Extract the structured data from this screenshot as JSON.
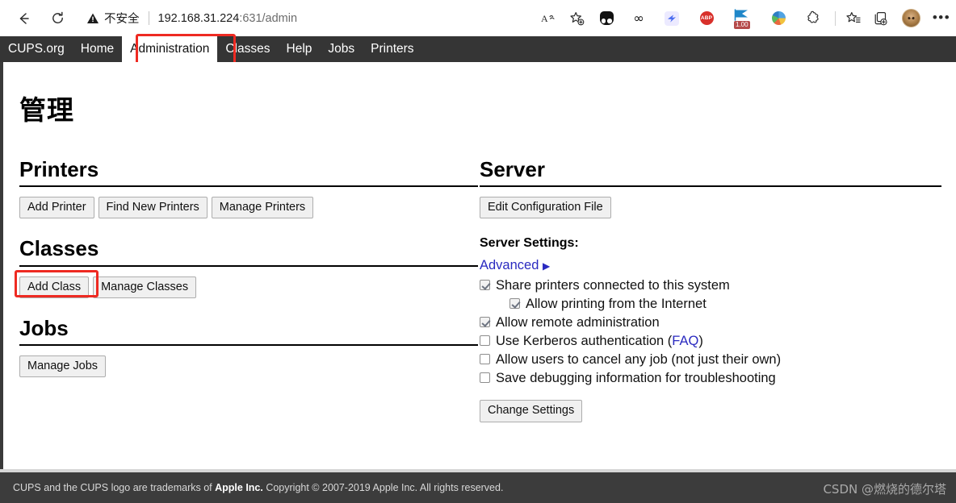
{
  "browser": {
    "back_icon": "back-arrow-icon",
    "reload_icon": "reload-icon",
    "security_label": "不安全",
    "url_host": "192.168.31.224",
    "url_rest": ":631/admin",
    "read_aloud_icon": "read-aloud-icon",
    "favorites_icon": "add-favorite-icon",
    "extensions": [
      {
        "name": "glasses-extension-icon",
        "label": ""
      },
      {
        "name": "infinity-extension-icon",
        "label": "∞"
      },
      {
        "name": "blue-bird-extension-icon",
        "label": ""
      },
      {
        "name": "adblock-plus-icon",
        "label": "ABP"
      },
      {
        "name": "flag-extension-icon",
        "label": "1.00"
      },
      {
        "name": "color-ball-extension-icon",
        "label": ""
      },
      {
        "name": "puzzle-extensions-icon",
        "label": ""
      }
    ],
    "split_screen_icon": "favorites-list-icon",
    "collections_icon": "collections-icon",
    "profile_icon": "profile-avatar",
    "more_icon": "more-options-icon"
  },
  "cups_nav": {
    "items": [
      {
        "label": "CUPS.org",
        "active": false
      },
      {
        "label": "Home",
        "active": false
      },
      {
        "label": "Administration",
        "active": true
      },
      {
        "label": "Classes",
        "active": false
      },
      {
        "label": "Help",
        "active": false
      },
      {
        "label": "Jobs",
        "active": false
      },
      {
        "label": "Printers",
        "active": false
      }
    ]
  },
  "page": {
    "title": "管理",
    "printers": {
      "heading": "Printers",
      "buttons": [
        "Add Printer",
        "Find New Printers",
        "Manage Printers"
      ]
    },
    "classes": {
      "heading": "Classes",
      "buttons": [
        "Add Class",
        "Manage Classes"
      ]
    },
    "jobs": {
      "heading": "Jobs",
      "buttons": [
        "Manage Jobs"
      ]
    },
    "server": {
      "heading": "Server",
      "edit_config_button": "Edit Configuration File",
      "settings_label": "Server Settings:",
      "advanced_link": "Advanced",
      "advanced_arrow": "▶",
      "checkboxes": [
        {
          "label": "Share printers connected to this system",
          "checked": true,
          "indent": false
        },
        {
          "label": "Allow printing from the Internet",
          "checked": true,
          "indent": true
        },
        {
          "label": "Allow remote administration",
          "checked": true,
          "indent": false
        },
        {
          "label": "Use Kerberos authentication (",
          "checked": false,
          "indent": false,
          "link": "FAQ",
          "label_after": ")"
        },
        {
          "label": "Allow users to cancel any job (not just their own)",
          "checked": false,
          "indent": false
        },
        {
          "label": "Save debugging information for troubleshooting",
          "checked": false,
          "indent": false
        }
      ],
      "change_settings_button": "Change Settings"
    }
  },
  "footer": {
    "text_before": "CUPS and the CUPS logo are trademarks of ",
    "text_bold": "Apple Inc.",
    "text_after": " Copyright © 2007-2019 Apple Inc. All rights reserved.",
    "watermark": "CSDN @燃烧的德尔塔"
  },
  "highlights": {
    "accent_red": "#ee2a22"
  }
}
